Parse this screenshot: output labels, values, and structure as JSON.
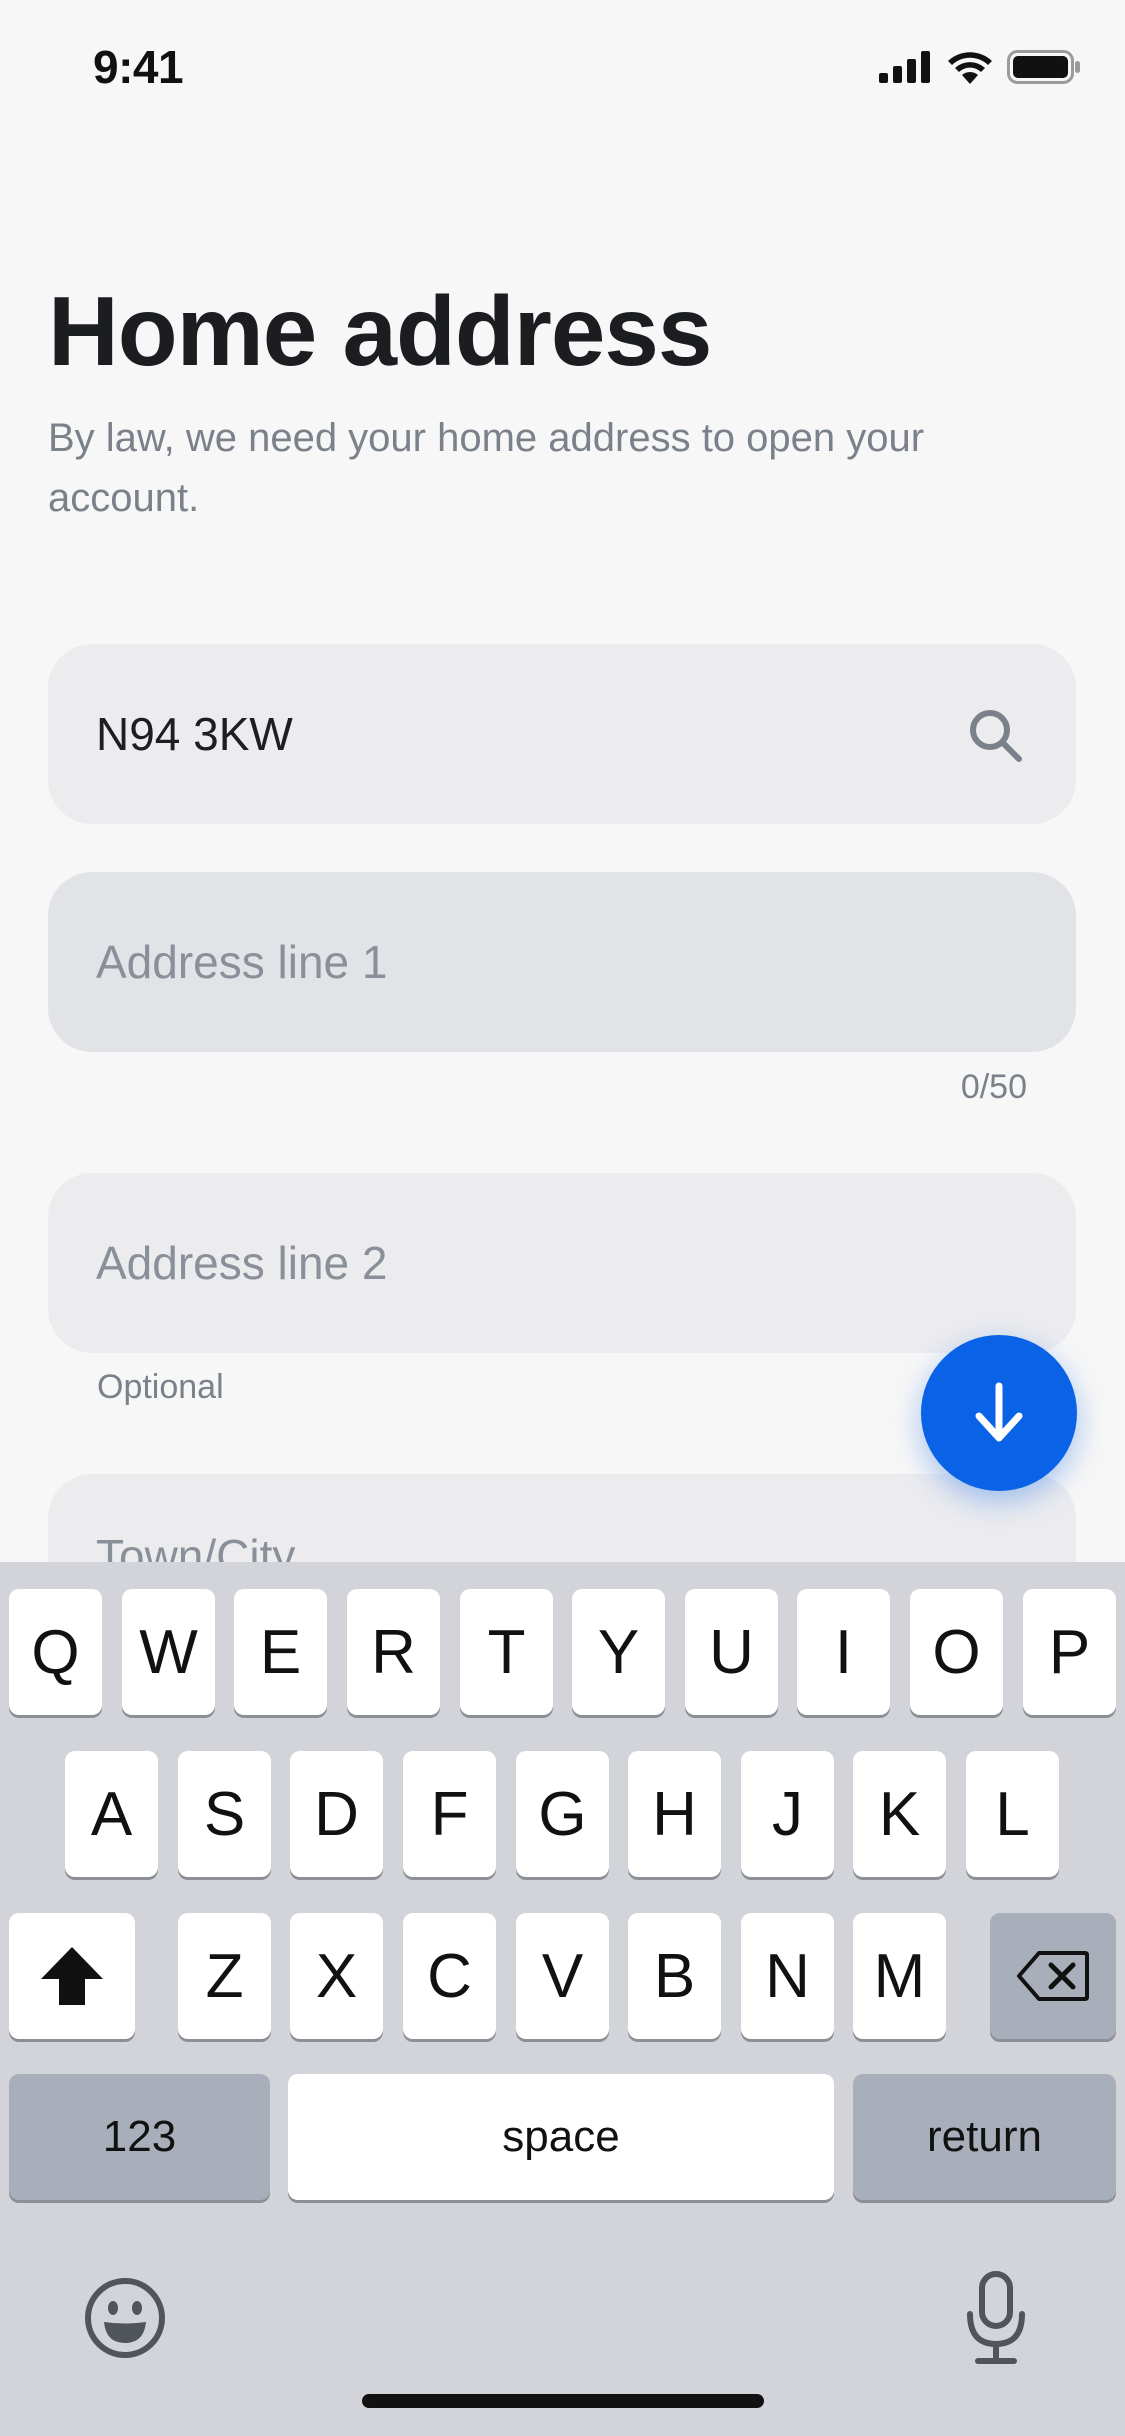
{
  "status_bar": {
    "time": "9:41"
  },
  "page": {
    "title": "Home address",
    "subtitle": "By law, we need your home address to open your account."
  },
  "form": {
    "postcode": {
      "value": "N94 3KW",
      "icon": "search-icon"
    },
    "address_line_1": {
      "placeholder": "Address line 1",
      "counter": "0/50"
    },
    "address_line_2": {
      "placeholder": "Address line 2",
      "helper": "Optional"
    },
    "town_city": {
      "placeholder": "Town/City"
    }
  },
  "fab": {
    "icon": "arrow-down-icon",
    "color": "#0a62e6"
  },
  "keyboard": {
    "row1": [
      "Q",
      "W",
      "E",
      "R",
      "T",
      "Y",
      "U",
      "I",
      "O",
      "P"
    ],
    "row2": [
      "A",
      "S",
      "D",
      "F",
      "G",
      "H",
      "J",
      "K",
      "L"
    ],
    "row3": [
      "Z",
      "X",
      "C",
      "V",
      "B",
      "N",
      "M"
    ],
    "numbers_label": "123",
    "space_label": "space",
    "return_label": "return"
  },
  "colors": {
    "accent": "#0a62e6",
    "background": "#f7f7f7",
    "keyboard": "#d2d4da"
  }
}
